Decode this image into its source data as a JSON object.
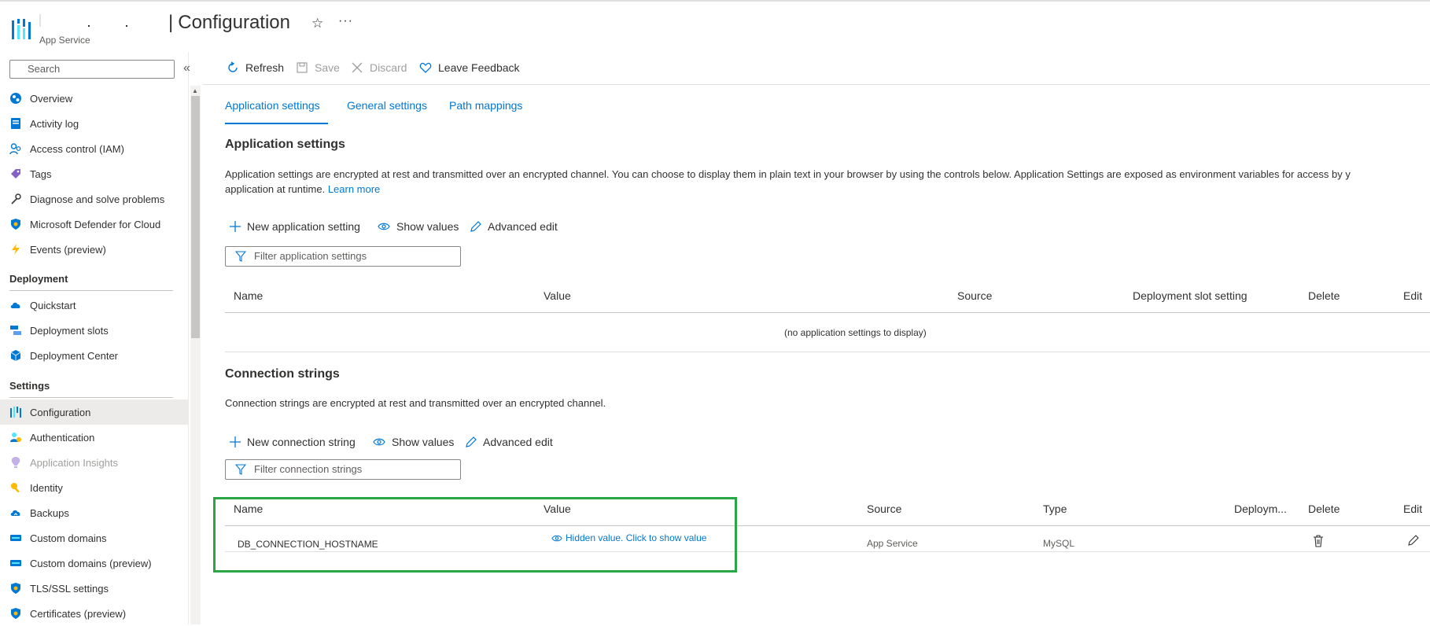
{
  "header": {
    "resource_name": "",
    "service_label": "App Service",
    "page_title": "Configuration",
    "title_separator": "|",
    "favorite_icon": "star-icon",
    "more_label": "···"
  },
  "sidebar": {
    "search_placeholder": "Search",
    "collapse_label": "«",
    "items_top": [
      {
        "label": "Overview",
        "icon": "overview-icon"
      },
      {
        "label": "Activity log",
        "icon": "activity-log-icon"
      },
      {
        "label": "Access control (IAM)",
        "icon": "iam-icon"
      },
      {
        "label": "Tags",
        "icon": "tag-icon"
      },
      {
        "label": "Diagnose and solve problems",
        "icon": "wrench-icon"
      },
      {
        "label": "Microsoft Defender for Cloud",
        "icon": "shield-icon"
      },
      {
        "label": "Events (preview)",
        "icon": "lightning-icon"
      }
    ],
    "deployment_heading": "Deployment",
    "deployment_items": [
      {
        "label": "Quickstart",
        "icon": "cloud-icon"
      },
      {
        "label": "Deployment slots",
        "icon": "slots-icon"
      },
      {
        "label": "Deployment Center",
        "icon": "cube-icon"
      }
    ],
    "settings_heading": "Settings",
    "settings_items": [
      {
        "label": "Configuration",
        "icon": "configuration-icon",
        "active": true
      },
      {
        "label": "Authentication",
        "icon": "authentication-icon"
      },
      {
        "label": "Application Insights",
        "icon": "insights-icon",
        "disabled": true
      },
      {
        "label": "Identity",
        "icon": "identity-key-icon"
      },
      {
        "label": "Backups",
        "icon": "backup-icon"
      },
      {
        "label": "Custom domains",
        "icon": "domain-icon"
      },
      {
        "label": "Custom domains (preview)",
        "icon": "domain-icon"
      },
      {
        "label": "TLS/SSL settings",
        "icon": "shield-icon"
      },
      {
        "label": "Certificates (preview)",
        "icon": "shield-icon"
      }
    ]
  },
  "toolbar": {
    "refresh_label": "Refresh",
    "save_label": "Save",
    "discard_label": "Discard",
    "feedback_label": "Leave Feedback"
  },
  "tabs": [
    {
      "label": "Application settings",
      "active": true
    },
    {
      "label": "General settings"
    },
    {
      "label": "Path mappings"
    }
  ],
  "app_settings": {
    "heading": "Application settings",
    "description_line1": "Application settings are encrypted at rest and transmitted over an encrypted channel. You can choose to display them in plain text in your browser by using the controls below. Application Settings are exposed as environment variables for access by y",
    "description_line2": "application at runtime.",
    "learn_more": "Learn more",
    "new_label": "New application setting",
    "show_values_label": "Show values",
    "advanced_edit_label": "Advanced edit",
    "filter_placeholder": "Filter application settings",
    "columns": [
      "Name",
      "Value",
      "Source",
      "Deployment slot setting",
      "Delete",
      "Edit"
    ],
    "empty_message": "(no application settings to display)"
  },
  "connection_strings": {
    "heading": "Connection strings",
    "description": "Connection strings are encrypted at rest and transmitted over an encrypted channel.",
    "new_label": "New connection string",
    "show_values_label": "Show values",
    "advanced_edit_label": "Advanced edit",
    "filter_placeholder": "Filter connection strings",
    "columns": [
      "Name",
      "Value",
      "Source",
      "Type",
      "Deploym...",
      "Delete",
      "Edit"
    ],
    "rows": [
      {
        "name": "DB_CONNECTION_HOSTNAME",
        "value": "Hidden value. Click to show value",
        "source": "App Service",
        "type": "MySQL"
      }
    ]
  },
  "colors": {
    "accent": "#0078d4",
    "highlight": "#2aa745"
  }
}
